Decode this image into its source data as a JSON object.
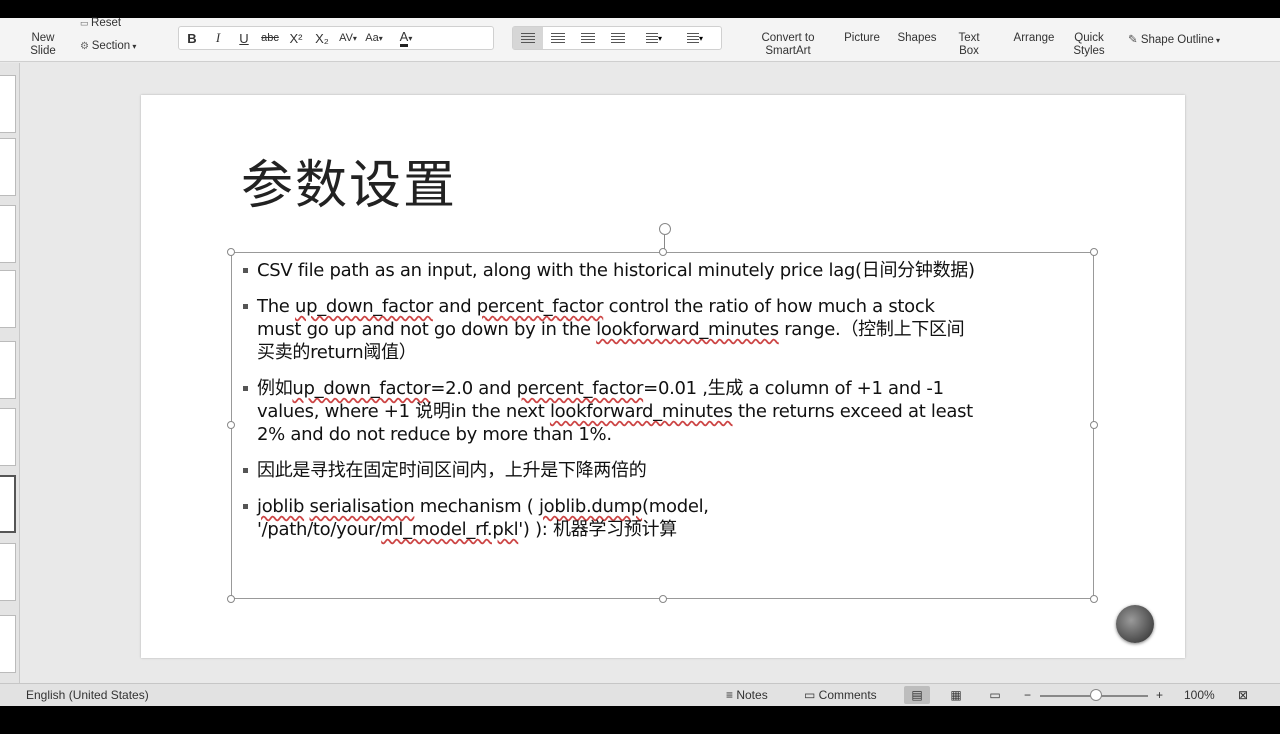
{
  "ribbon": {
    "new_slide": "New\nSlide",
    "reset": "Reset",
    "section": "Section",
    "format": {
      "bold": "B",
      "italic": "I",
      "underline": "U",
      "strike": "abc",
      "superscript": "X²",
      "subscript": "X₂",
      "spacing": "AV",
      "case": "Aa",
      "font_color": "A"
    },
    "convert_smartart": "Convert to\nSmartArt",
    "picture": "Picture",
    "shapes": "Shapes",
    "text_box": "Text\nBox",
    "arrange": "Arrange",
    "quick_styles": "Quick\nStyles",
    "shape_outline": "Shape Outline"
  },
  "slide": {
    "title": "参数设置",
    "bullets": [
      {
        "lines": [
          [
            {
              "t": "CSV file path as an input, along with the historical minutely price lag(日间分钟数据)"
            }
          ]
        ]
      },
      {
        "lines": [
          [
            {
              "t": "The "
            },
            {
              "t": "up_down_factor",
              "sq": true
            },
            {
              "t": " and "
            },
            {
              "t": "percent_factor",
              "sq": true
            },
            {
              "t": " control the ratio of how much a stock"
            }
          ],
          [
            {
              "t": "must go up and not go down by in the "
            },
            {
              "t": "lookforward_minutes",
              "sq": true
            },
            {
              "t": " range.（控制上下区间"
            }
          ],
          [
            {
              "t": "买卖的return阈值）"
            }
          ]
        ]
      },
      {
        "lines": [
          [
            {
              "t": "例如"
            },
            {
              "t": "up_down_factor",
              "sq": true
            },
            {
              "t": "=2.0 and "
            },
            {
              "t": "percent_factor",
              "sq": true
            },
            {
              "t": "=0.01 ,生成 a column of +1 and -1"
            }
          ],
          [
            {
              "t": "values, where +1 说明in the next "
            },
            {
              "t": "lookforward_minutes",
              "sq": true
            },
            {
              "t": " the returns exceed at least"
            }
          ],
          [
            {
              "t": "2% and do not reduce by more than 1%."
            }
          ]
        ]
      },
      {
        "lines": [
          [
            {
              "t": "因此是寻找在固定时间区间内，上升是下降两倍的"
            }
          ]
        ]
      },
      {
        "lines": [
          [
            {
              "t": " "
            },
            {
              "t": "joblib",
              "sq": true
            },
            {
              "t": " "
            },
            {
              "t": "serialisation",
              "sq": true
            },
            {
              "t": " mechanism ( "
            },
            {
              "t": "joblib.dump",
              "sq": true
            },
            {
              "t": "(model,"
            }
          ],
          [
            {
              "t": "'/path/to/your/"
            },
            {
              "t": "ml_model_rf.pkl",
              "sq": true
            },
            {
              "t": "') ): 机器学习预计算"
            }
          ]
        ]
      }
    ]
  },
  "status": {
    "language": "English (United States)",
    "notes": "Notes",
    "comments": "Comments",
    "zoom": "100%"
  }
}
